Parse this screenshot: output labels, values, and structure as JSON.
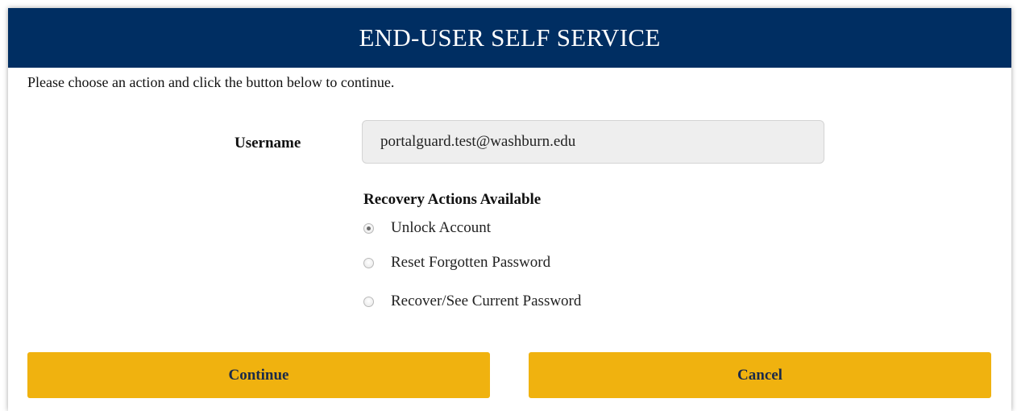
{
  "header": {
    "title": "END-USER SELF SERVICE"
  },
  "instructions": "Please choose an action and click the button below to continue.",
  "username": {
    "label": "Username",
    "value": "portalguard.test@washburn.edu"
  },
  "recovery": {
    "title": "Recovery Actions Available",
    "options": [
      {
        "label": "Unlock Account",
        "checked": true
      },
      {
        "label": "Reset Forgotten Password",
        "checked": false
      },
      {
        "label": "Recover/See Current Password",
        "checked": false
      }
    ]
  },
  "buttons": {
    "continue_label": "Continue",
    "cancel_label": "Cancel"
  },
  "colors": {
    "header_bg": "#002e62",
    "button_bg": "#f0b20f",
    "button_text": "#1a2a4a"
  }
}
